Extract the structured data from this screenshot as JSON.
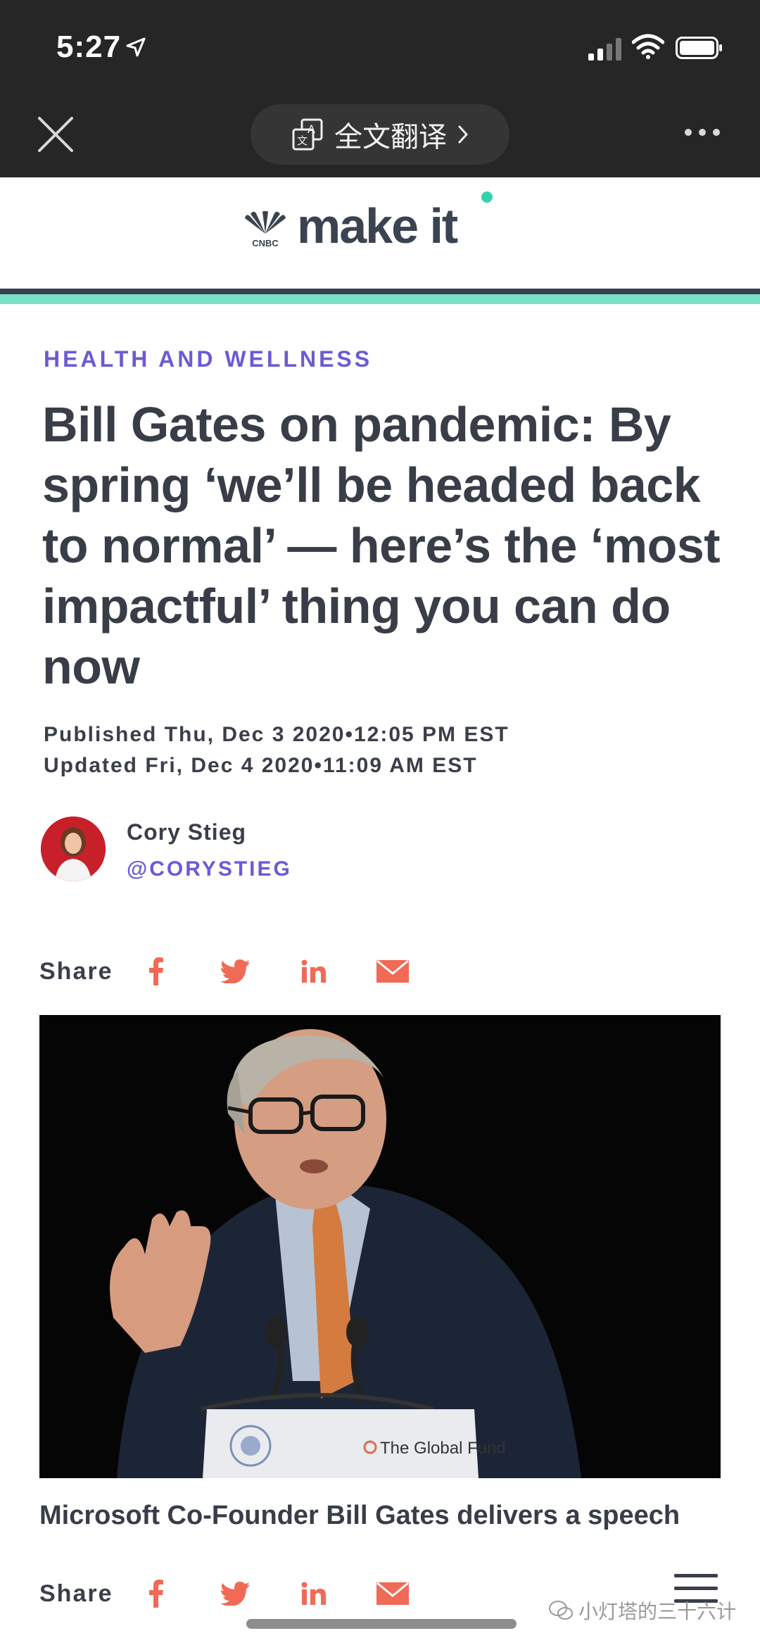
{
  "status_bar": {
    "time": "5:27",
    "icons": [
      "location-arrow-icon",
      "signal-icon",
      "wifi-icon",
      "battery-icon"
    ]
  },
  "browser_toolbar": {
    "close_icon": "close-icon",
    "translate_label": "全文翻译",
    "translate_icon": "translate-icon",
    "more_icon": "more-icon"
  },
  "site": {
    "logo_small_text": "CNBC",
    "logo_text": "make it",
    "accent_color": "#34d1ad",
    "rule_color": "#384050"
  },
  "article": {
    "category": "HEALTH AND WELLNESS",
    "headline": "Bill Gates on pandemic: By spring ‘we’ll be headed back to normal’ — here’s the ‘most impactful’ thing you can do now",
    "published": "Published Thu, Dec 3 2020•12:05 PM EST",
    "updated": "Updated Fri, Dec 4 2020•11:09 AM EST",
    "author_name": "Cory Stieg",
    "author_handle": "@CORYSTIEG",
    "share_label": "Share",
    "share_icons": [
      "facebook-icon",
      "twitter-icon",
      "linkedin-icon",
      "email-icon"
    ],
    "share_color": "#f06a55",
    "photo_podium_text": "The Global Fund",
    "caption": "Microsoft Co-Founder Bill Gates delivers a speech"
  },
  "footer": {
    "menu_icon": "hamburger-icon",
    "watermark": "小灯塔的三十六计"
  }
}
